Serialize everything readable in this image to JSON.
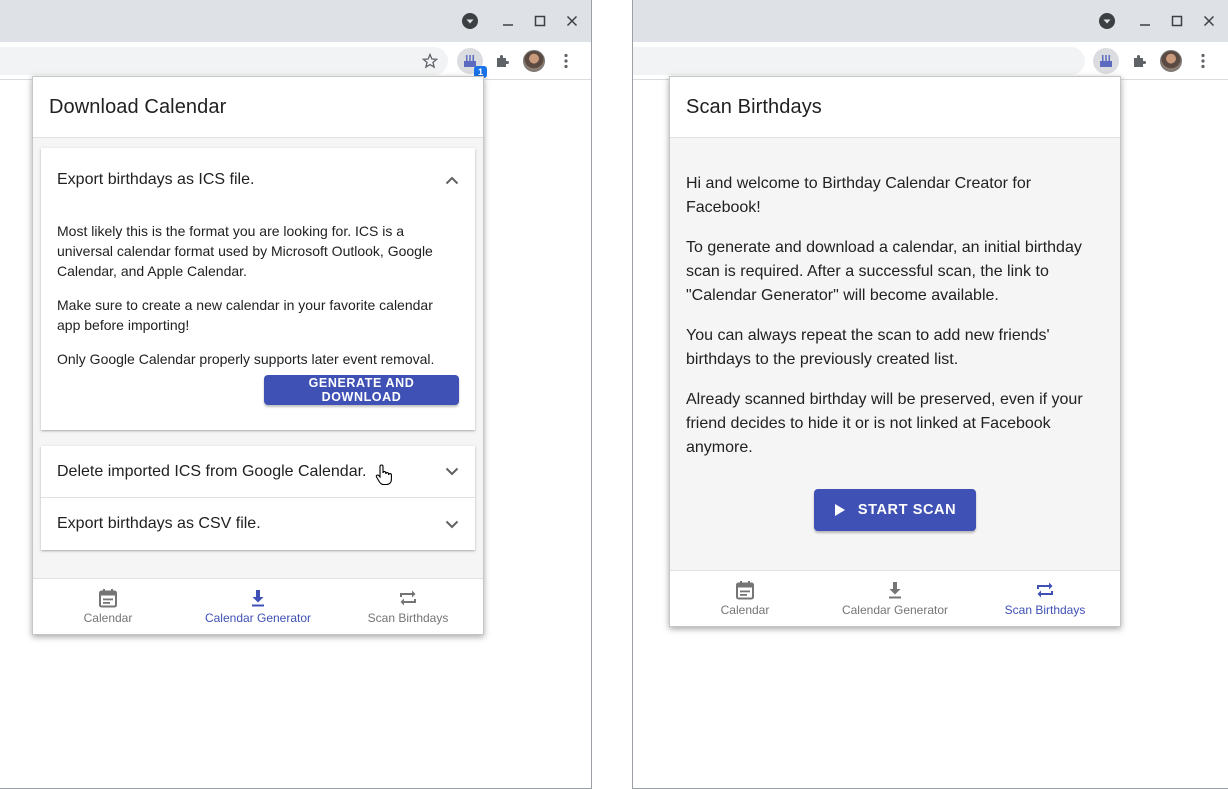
{
  "colors": {
    "accent": "#3f51b5",
    "titlebar": "#dee1e6",
    "ext_badge": "#1a73e8"
  },
  "left": {
    "toolbar": {
      "extension_badge": "1"
    },
    "popup": {
      "title": "Download Calendar",
      "accordion": [
        {
          "title": "Export birthdays as ICS file.",
          "expanded": true,
          "paragraphs": [
            "Most likely this is the format you are looking for. ICS is a universal calendar format used by Microsoft Outlook, Google Calendar, and Apple Calendar.",
            "Make sure to create a new calendar in your favorite calendar app before importing!",
            "Only Google Calendar properly supports later event removal."
          ],
          "button_label": "GENERATE AND DOWNLOAD"
        },
        {
          "title": "Delete imported ICS from Google Calendar.",
          "expanded": false
        },
        {
          "title": "Export birthdays as CSV file.",
          "expanded": false
        }
      ],
      "nav": [
        {
          "label": "Calendar",
          "icon": "calendar-icon",
          "active": false
        },
        {
          "label": "Calendar Generator",
          "icon": "download-icon",
          "active": true
        },
        {
          "label": "Scan Birthdays",
          "icon": "repeat-icon",
          "active": false
        }
      ]
    }
  },
  "right": {
    "popup": {
      "title": "Scan Birthdays",
      "paragraphs": [
        "Hi and welcome to Birthday Calendar Creator for Facebook!",
        "To generate and download a calendar, an initial birthday scan is required. After a successful scan, the link to \"Calendar Generator\" will become available.",
        "You can always repeat the scan to add new friends' birthdays to the previously created list.",
        "Already scanned birthday will be preserved, even if your friend decides to hide it or is not linked at Facebook anymore."
      ],
      "button_label": "START SCAN",
      "nav": [
        {
          "label": "Calendar",
          "icon": "calendar-icon",
          "active": false
        },
        {
          "label": "Calendar Generator",
          "icon": "download-icon",
          "active": false
        },
        {
          "label": "Scan Birthdays",
          "icon": "repeat-icon",
          "active": true
        }
      ]
    }
  }
}
